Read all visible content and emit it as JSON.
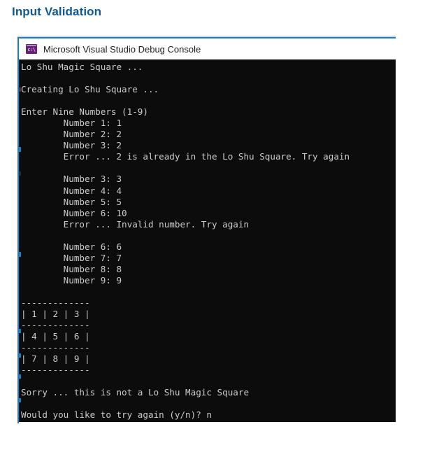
{
  "page": {
    "heading": "Input Validation",
    "background_color": "#ffffff",
    "heading_color": "#0e5a96"
  },
  "console_window": {
    "accent_color": "#1b7fc4",
    "titlebar": {
      "icon_name": "console-app-icon",
      "icon_glyph": "c:\\",
      "icon_color": "#68217a",
      "title": "Microsoft Visual Studio Debug Console"
    },
    "screen": {
      "background_color": "#0c0c0c",
      "text_color": "#cccccc",
      "lines": [
        "Lo Shu Magic Square ...",
        "",
        "Creating Lo Shu Square ...",
        "",
        "Enter Nine Numbers (1-9)",
        "        Number 1: 1",
        "        Number 2: 2",
        "        Number 3: 2",
        "        Error ... 2 is already in the Lo Shu Square. Try again",
        "",
        "        Number 3: 3",
        "        Number 4: 4",
        "        Number 5: 5",
        "        Number 6: 10",
        "        Error ... Invalid number. Try again",
        "",
        "        Number 6: 6",
        "        Number 7: 7",
        "        Number 8: 8",
        "        Number 9: 9",
        "",
        "-------------",
        "| 1 | 2 | 3 |",
        "-------------",
        "| 4 | 5 | 6 |",
        "-------------",
        "| 7 | 8 | 9 |",
        "-------------",
        "",
        "Sorry ... this is not a Lo Shu Magic Square",
        "",
        "Would you like to try again (y/n)? n"
      ],
      "prompts": {
        "enter_numbers": "Enter Nine Numbers (1-9)",
        "duplicate_error": "Error ... 2 is already in the Lo Shu Square. Try again",
        "invalid_error": "Error ... Invalid number. Try again",
        "result": "Sorry ... this is not a Lo Shu Magic Square",
        "retry_question": "Would you like to try again (y/n)?",
        "retry_answer": "n"
      },
      "square": {
        "rows": [
          [
            1,
            2,
            3
          ],
          [
            4,
            5,
            6
          ],
          [
            7,
            8,
            9
          ]
        ],
        "divider": "-------------"
      },
      "entered_numbers": [
        1,
        2,
        2,
        3,
        4,
        5,
        10,
        6,
        7,
        8,
        9
      ]
    }
  }
}
